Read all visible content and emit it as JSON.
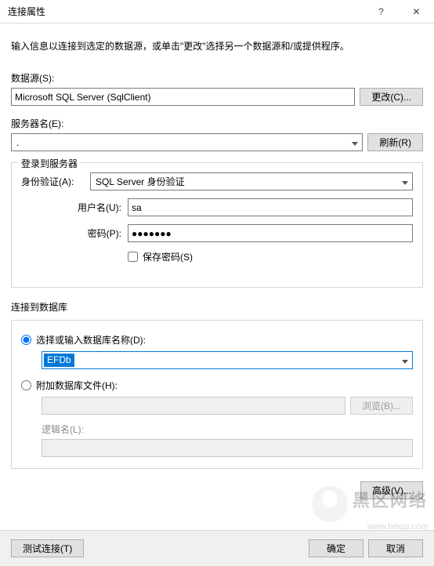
{
  "window": {
    "title": "连接属性",
    "help": "?",
    "close": "✕"
  },
  "instruction": "输入信息以连接到选定的数据源，或单击\"更改\"选择另一个数据源和/或提供程序。",
  "datasource": {
    "label": "数据源(S):",
    "value": "Microsoft SQL Server (SqlClient)",
    "change_btn": "更改(C)..."
  },
  "server": {
    "label": "服务器名(E):",
    "value": ".",
    "refresh_btn": "刷新(R)"
  },
  "login_group": {
    "legend": "登录到服务器",
    "auth_label": "身份验证(A):",
    "auth_value": "SQL Server 身份验证",
    "user_label": "用户名(U):",
    "user_value": "sa",
    "pass_label": "密码(P):",
    "pass_value": "●●●●●●●",
    "save_pass_label": "保存密码(S)"
  },
  "db_group": {
    "legend": "连接到数据库",
    "radio_select_label": "选择或输入数据库名称(D):",
    "db_value": "EFDb",
    "radio_attach_label": "附加数据库文件(H):",
    "attach_path": "",
    "browse_btn": "浏览(B)...",
    "logical_label": "逻辑名(L):",
    "logical_value": ""
  },
  "advanced_btn": "高级(V)...",
  "footer": {
    "test_btn": "测试连接(T)",
    "ok_btn": "确定",
    "cancel_btn": "取消"
  },
  "watermark": {
    "text": "黑区网络",
    "url": "www.heiqu.com"
  }
}
